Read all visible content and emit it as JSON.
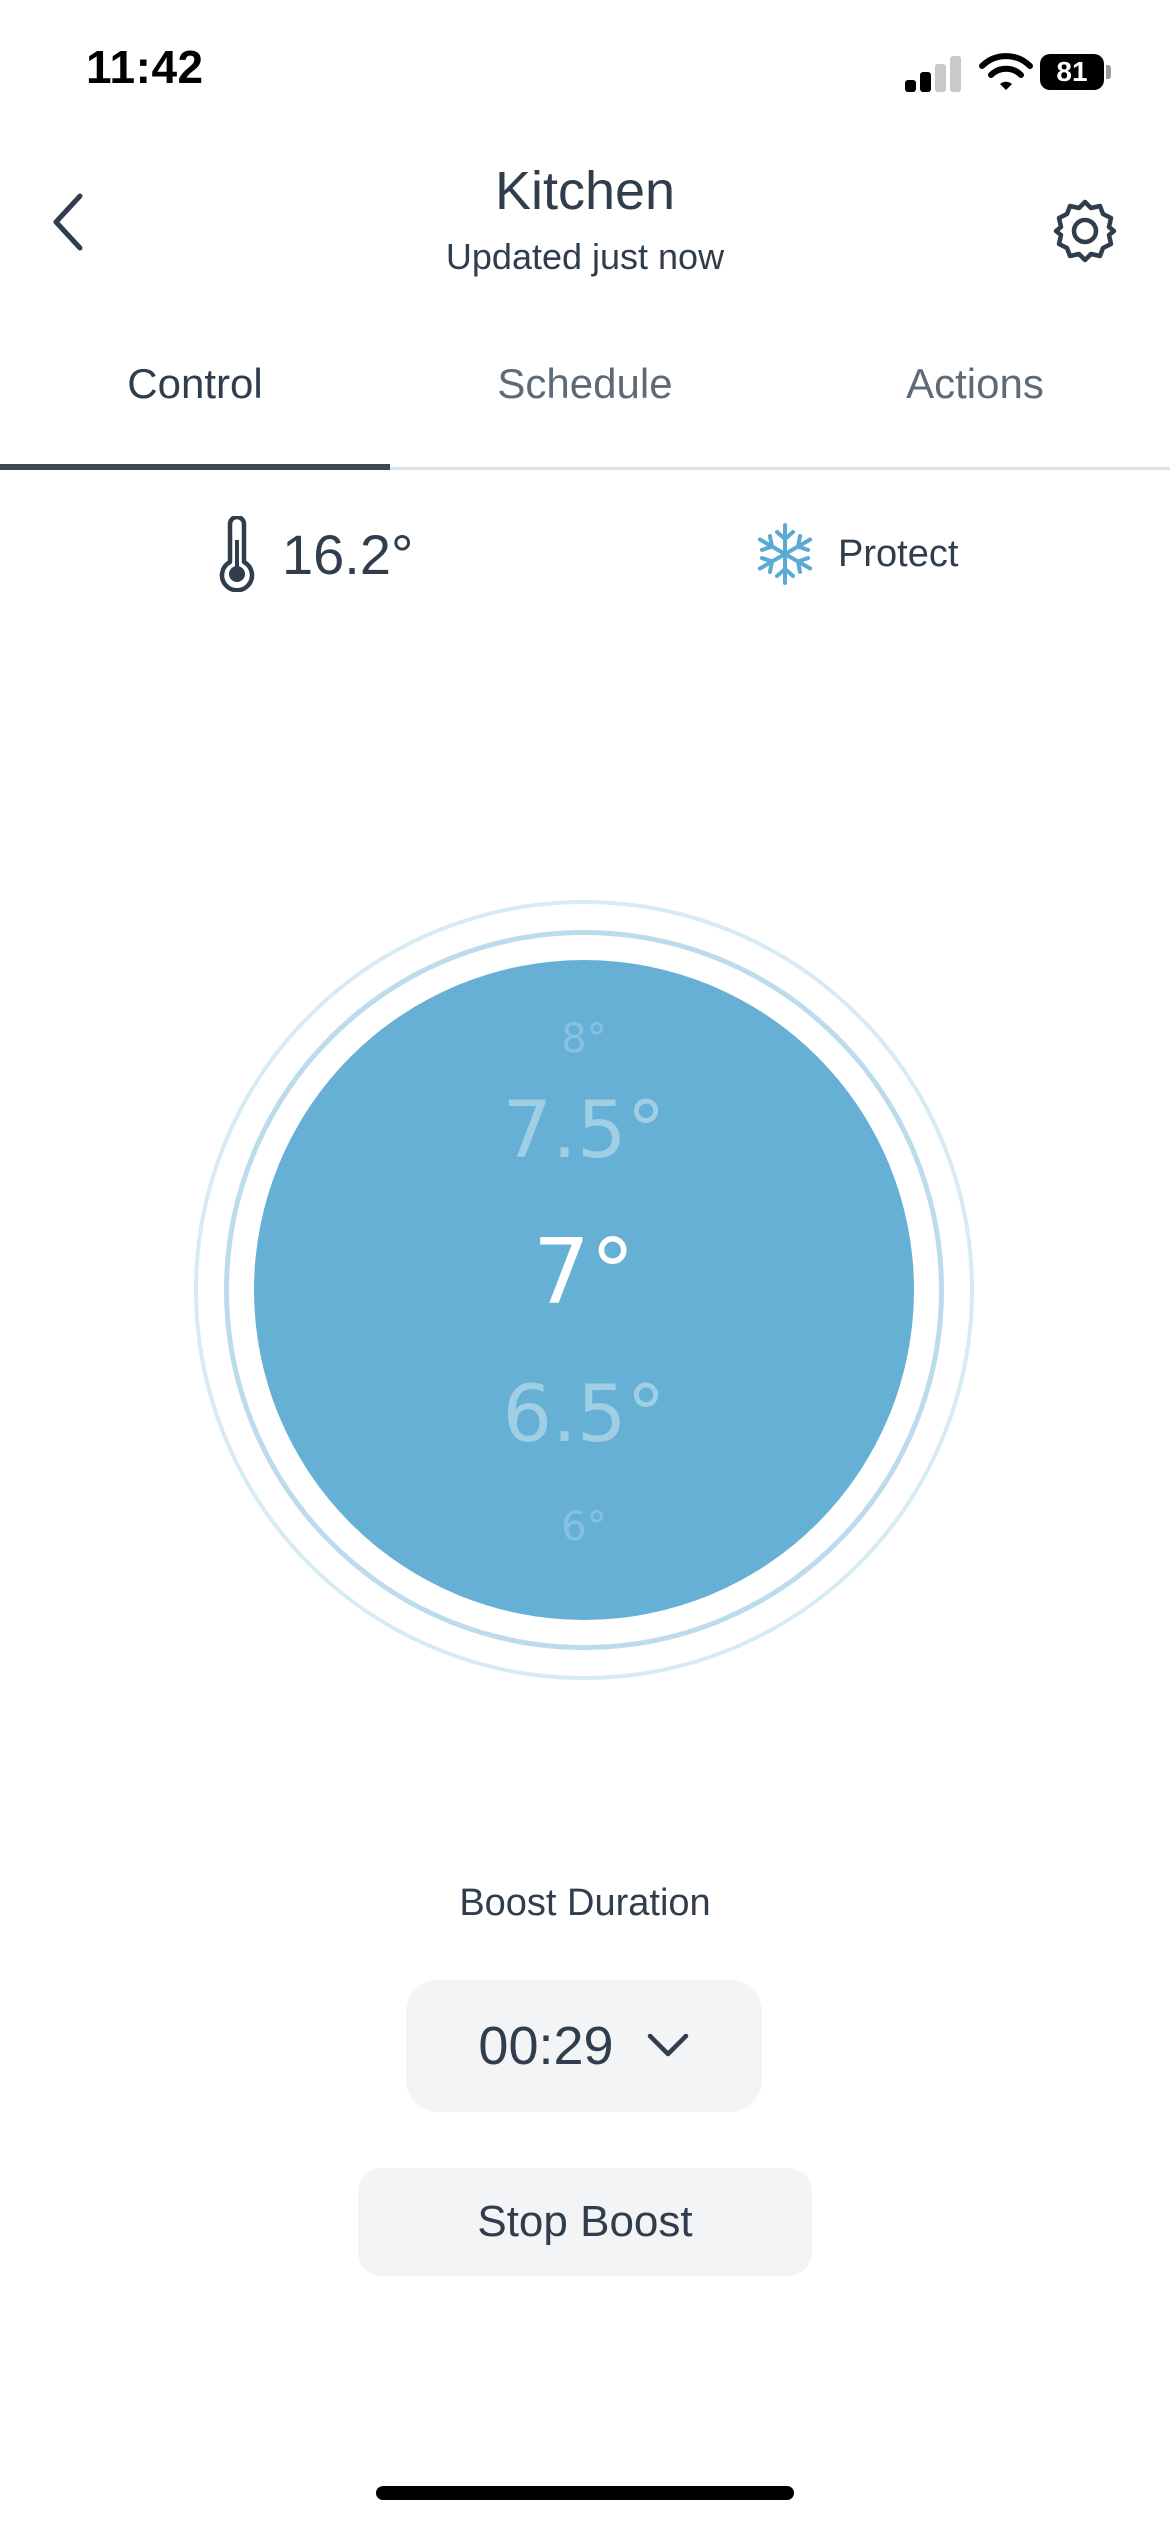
{
  "status_bar": {
    "time": "11:42",
    "battery_level": "81"
  },
  "header": {
    "title": "Kitchen",
    "subtitle": "Updated just now"
  },
  "tabs": [
    {
      "label": "Control",
      "active": true
    },
    {
      "label": "Schedule",
      "active": false
    },
    {
      "label": "Actions",
      "active": false
    }
  ],
  "info": {
    "current_temperature": "16.2°",
    "mode_label": "Protect"
  },
  "dial": {
    "values": [
      "8°",
      "7.5°",
      "7°",
      "6.5°",
      "6°"
    ],
    "selected": "7°"
  },
  "boost": {
    "label": "Boost Duration",
    "duration": "00:29",
    "stop_label": "Stop Boost"
  },
  "colors": {
    "dial_fill": "#66b0d6",
    "ring": "#c4e1ef",
    "snowflake": "#5aaad3",
    "text": "#2f3d4c",
    "button_bg": "#f2f4f5"
  }
}
